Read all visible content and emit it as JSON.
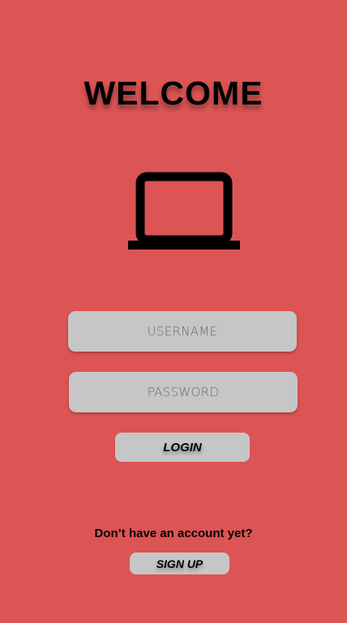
{
  "screen": {
    "title": "WELCOME",
    "icon": "laptop-icon",
    "background_color": "#dc5454"
  },
  "form": {
    "username_placeholder": "USERNAME",
    "username_value": "",
    "password_placeholder": "PASSWORD",
    "password_value": "",
    "login_label": "LOGIN"
  },
  "footer": {
    "prompt": "Don’t have an account yet?",
    "signup_label": "SIGN UP"
  }
}
